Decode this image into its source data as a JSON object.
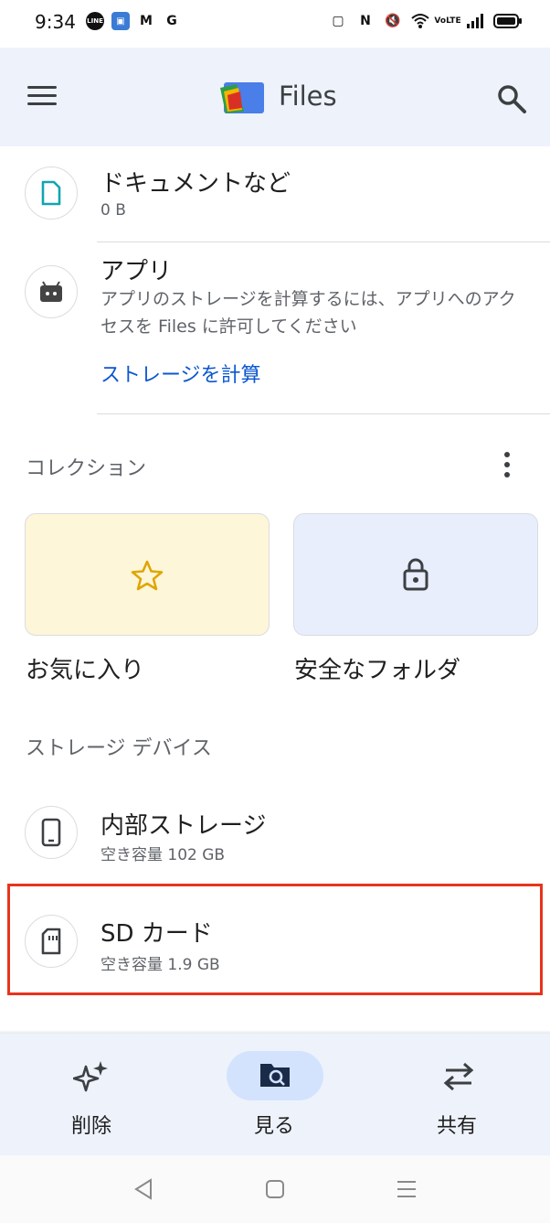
{
  "status_bar": {
    "time": "9:34",
    "left_icons": [
      "line-icon",
      "android-box-icon",
      "gmail-icon",
      "google-icon"
    ],
    "right_icons": [
      "screen-off-icon",
      "nfc-icon",
      "mute-vibrate-icon",
      "wifi-icon",
      "volte-icon",
      "signal-icon",
      "battery-icon"
    ]
  },
  "app_bar": {
    "title": "Files"
  },
  "rows": {
    "documents": {
      "title": "ドキュメントなど",
      "subtitle": "0 B"
    },
    "apps": {
      "title": "アプリ",
      "desc_line1": "アプリのストレージを計算するには、アプリへのアク",
      "desc_line2": "セスを Files に許可してください",
      "link": "ストレージを計算"
    }
  },
  "collections": {
    "label": "コレクション",
    "favorites_label": "お気に入り",
    "safe_folder_label": "安全なフォルダ"
  },
  "storage": {
    "label": "ストレージ デバイス",
    "internal": {
      "title": "内部ストレージ",
      "subtitle": "空き容量 102 GB"
    },
    "sd": {
      "title": "SD カード",
      "subtitle": "空き容量 1.9 GB"
    }
  },
  "bottom_nav": {
    "items": [
      {
        "label": "削除",
        "icon": "sparkle-icon"
      },
      {
        "label": "見る",
        "icon": "browse-icon",
        "selected": true
      },
      {
        "label": "共有",
        "icon": "swap-icon"
      }
    ]
  },
  "colors": {
    "accent": "#0b57d0",
    "highlight": "#e8331c",
    "favorites_card": "#fdf6d8",
    "safe_card": "#e8eefb"
  }
}
